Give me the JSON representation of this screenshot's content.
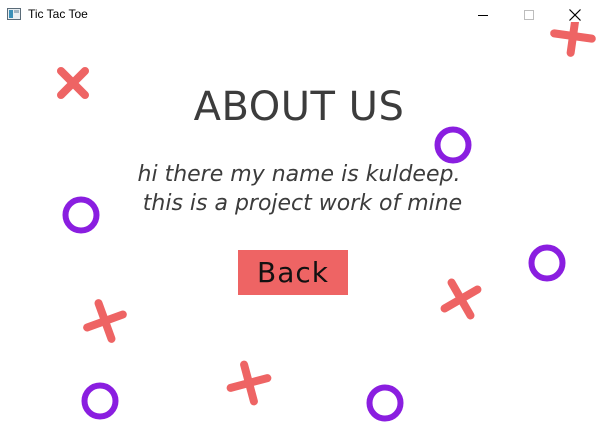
{
  "window": {
    "title": "Tic Tac Toe",
    "controls": [
      "minimize",
      "maximize",
      "close"
    ]
  },
  "about": {
    "heading": "ABOUT US",
    "description": "hi there my name is kuldeep.\n this is a project work of mine",
    "back_label": "Back"
  },
  "colors": {
    "cross": "#ee6464",
    "circle": "#8a1ee0",
    "heading_text": "#3c3c3c",
    "button_bg": "#ee6464"
  },
  "decorations": {
    "cross_icon": "x-mark",
    "circle_icon": "o-ring"
  }
}
